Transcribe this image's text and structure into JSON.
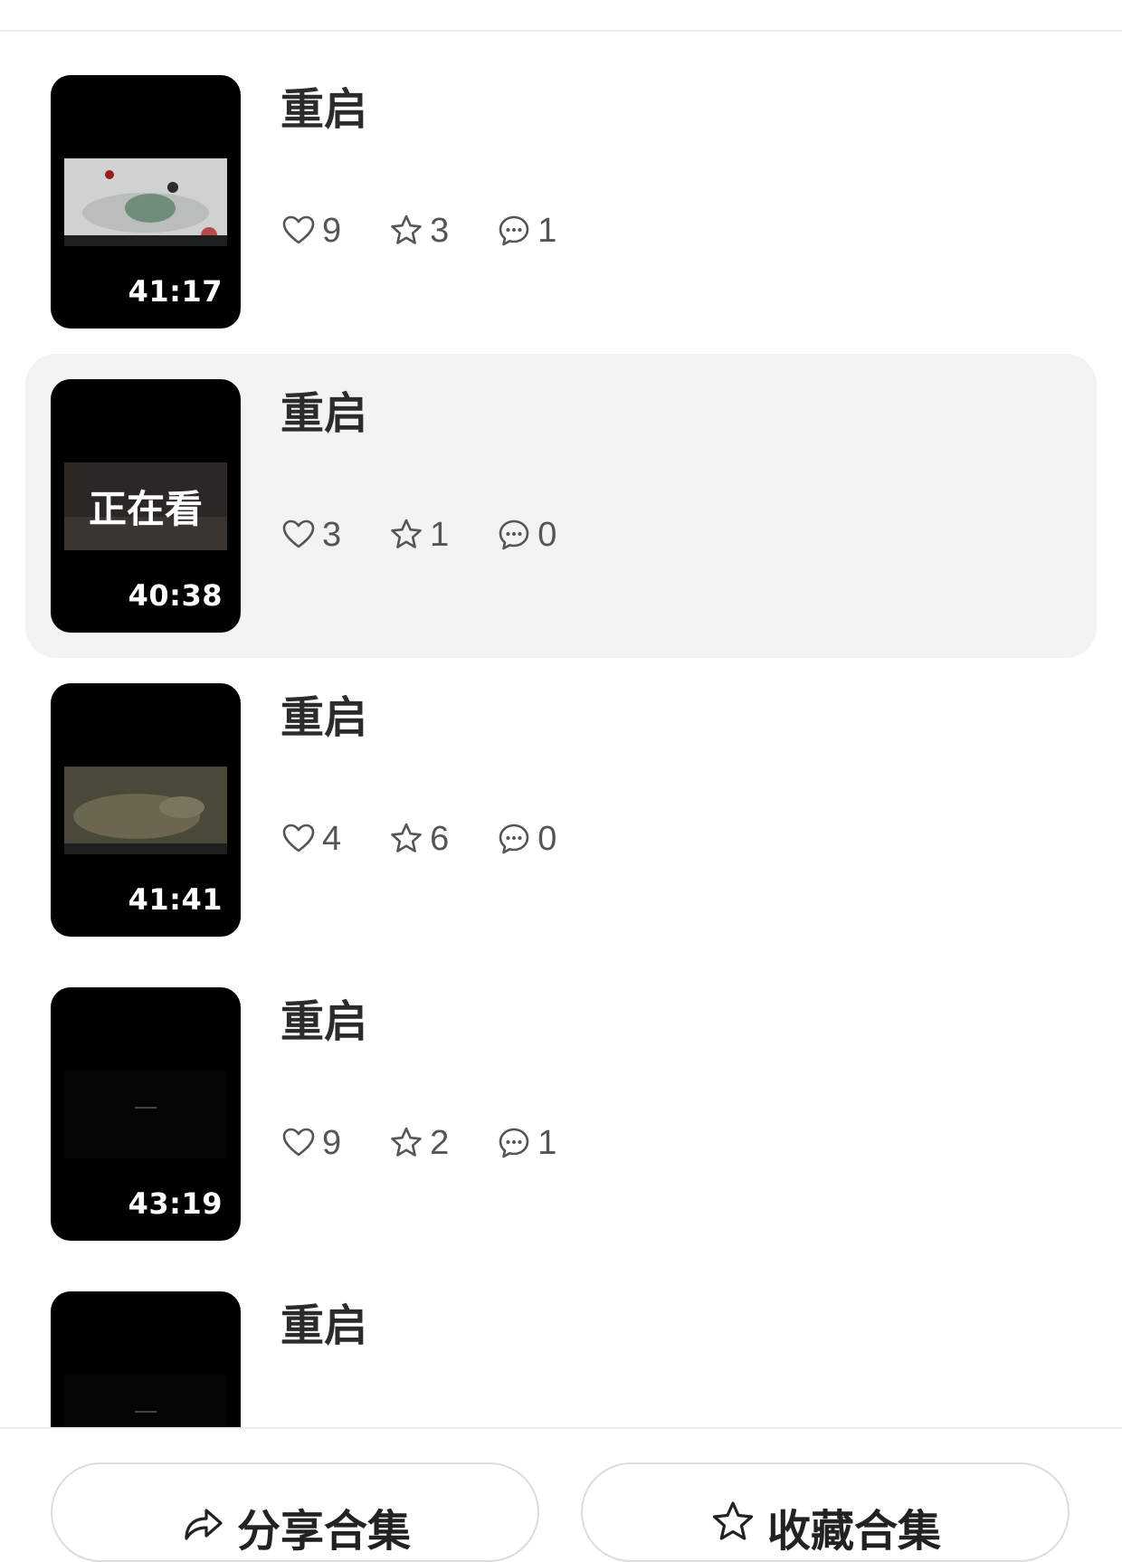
{
  "episodes": [
    {
      "title": "重启",
      "duration": "41:17",
      "likes": "9",
      "stars": "3",
      "comments": "1",
      "status": ""
    },
    {
      "title": "重启",
      "duration": "40:38",
      "likes": "3",
      "stars": "1",
      "comments": "0",
      "status": "正在看"
    },
    {
      "title": "重启",
      "duration": "41:41",
      "likes": "4",
      "stars": "6",
      "comments": "0",
      "status": ""
    },
    {
      "title": "重启",
      "duration": "43:19",
      "likes": "9",
      "stars": "2",
      "comments": "1",
      "status": ""
    },
    {
      "title": "重启",
      "duration": "",
      "likes": "",
      "stars": "",
      "comments": "",
      "status": ""
    }
  ],
  "bottom": {
    "share_label": "分享合集",
    "collect_label": "收藏合集"
  },
  "colors": {
    "active_row_bg": "#f3f3f3",
    "thumb_bg": "#000000",
    "icon_stroke": "#555555"
  }
}
